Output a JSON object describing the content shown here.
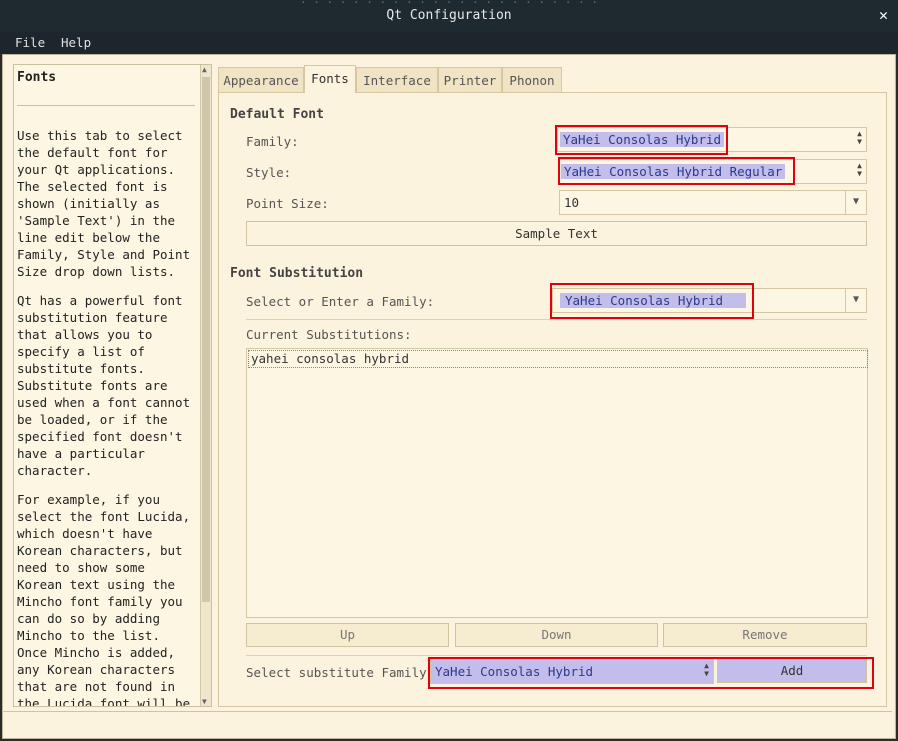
{
  "window": {
    "title": "Qt Configuration"
  },
  "menu": {
    "file": "File",
    "help": "Help"
  },
  "help": {
    "title": "Fonts",
    "paragraphs": [
      "Use this tab to select the default font for your Qt applications. The selected font is shown (initially as 'Sample Text') in the line edit below the Family, Style and Point Size drop down lists.",
      "Qt has a powerful font substitution feature that allows you to specify a list of substitute fonts. Substitute fonts are used when a font cannot be loaded, or if the specified font doesn't have a particular character.",
      "For example, if you select the font Lucida, which doesn't have Korean characters, but need to show some Korean text using the Mincho font family you can do so by adding Mincho to the list. Once Mincho is added, any Korean characters that are not found in the Lucida font will be taken from the"
    ]
  },
  "tabs": [
    "Appearance",
    "Fonts",
    "Interface",
    "Printer",
    "Phonon"
  ],
  "default_font": {
    "group_title": "Default Font",
    "family_label": "Family:",
    "family_value": "YaHei Consolas Hybrid",
    "style_label": "Style:",
    "style_value": "YaHei Consolas Hybrid Regular",
    "size_label": "Point Size:",
    "size_value": "10",
    "sample_text": "Sample Text"
  },
  "substitution": {
    "group_title": "Font Substitution",
    "select_label": "Select or Enter a Family:",
    "select_value": "YaHei Consolas Hybrid",
    "current_label": "Current Substitutions:",
    "current_items": [
      "yahei consolas hybrid"
    ],
    "up_label": "Up",
    "down_label": "Down",
    "remove_label": "Remove",
    "substitute_label": "Select substitute Family:",
    "substitute_value": "YaHei Consolas Hybrid",
    "add_label": "Add"
  },
  "colors": {
    "highlight": "#c3bdeb",
    "annotation": "#e00010",
    "background": "#fcf3de"
  }
}
